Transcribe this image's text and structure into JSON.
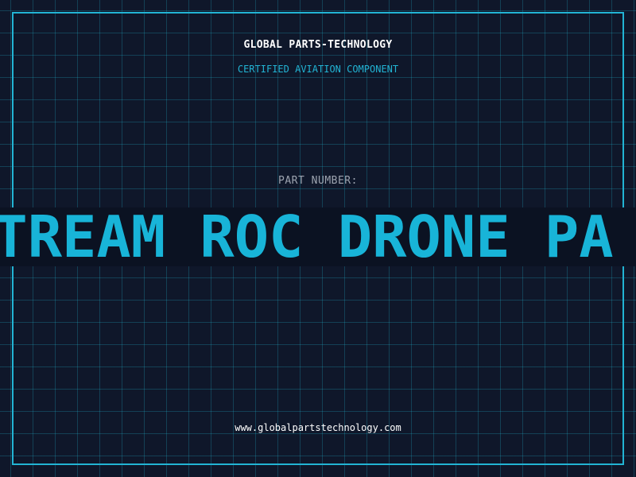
{
  "colors": {
    "background": "#0f172a",
    "grid": "#22b4d4",
    "accent": "#18b4d8",
    "label": "#9ca3af",
    "text": "#ffffff"
  },
  "header": {
    "company": "GLOBAL PARTS-TECHNOLOGY",
    "subtitle": "CERTIFIED AVIATION COMPONENT"
  },
  "part": {
    "label": "PART NUMBER:",
    "number": "STREAM ROC DRONE PA"
  },
  "footer": {
    "website": "www.globalpartstechnology.com"
  }
}
